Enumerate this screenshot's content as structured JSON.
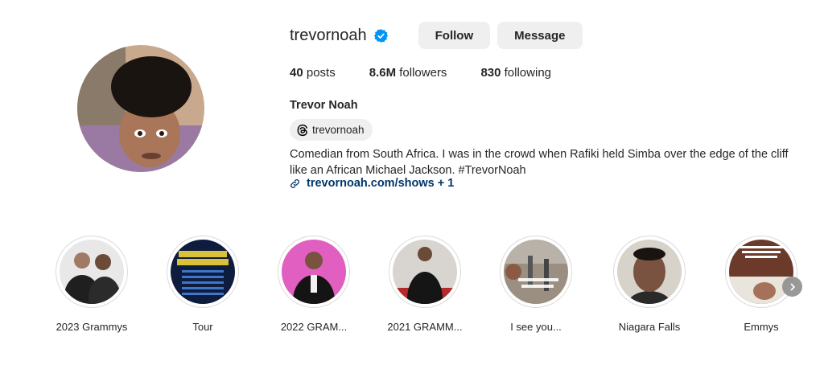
{
  "profile": {
    "username": "trevornoah",
    "verified": true,
    "follow_label": "Follow",
    "message_label": "Message",
    "stats": {
      "posts_count": "40",
      "posts_label": " posts",
      "followers_count": "8.6M",
      "followers_label": " followers",
      "following_count": "830",
      "following_label": " following"
    },
    "full_name": "Trevor Noah",
    "threads_handle": "trevornoah",
    "bio": "Comedian from South Africa. I was in the crowd when Rafiki held Simba over the edge of the cliff like an African Michael Jackson. #TrevorNoah",
    "link_text": "trevornoah.com/shows + 1"
  },
  "highlights": [
    {
      "label": "2023 Grammys"
    },
    {
      "label": "Tour"
    },
    {
      "label": "2022 GRAM..."
    },
    {
      "label": "2021 GRAMM..."
    },
    {
      "label": "I see you..."
    },
    {
      "label": "Niagara Falls"
    },
    {
      "label": "Emmys"
    }
  ],
  "colors": {
    "verified_blue": "#0095f6",
    "button_bg": "#efefef",
    "link_color": "#00376b",
    "ring_border": "#dbdbdb"
  },
  "icons": {
    "verified": "verified-badge-icon",
    "threads": "threads-icon",
    "link": "link-icon",
    "next": "chevron-right-icon"
  }
}
